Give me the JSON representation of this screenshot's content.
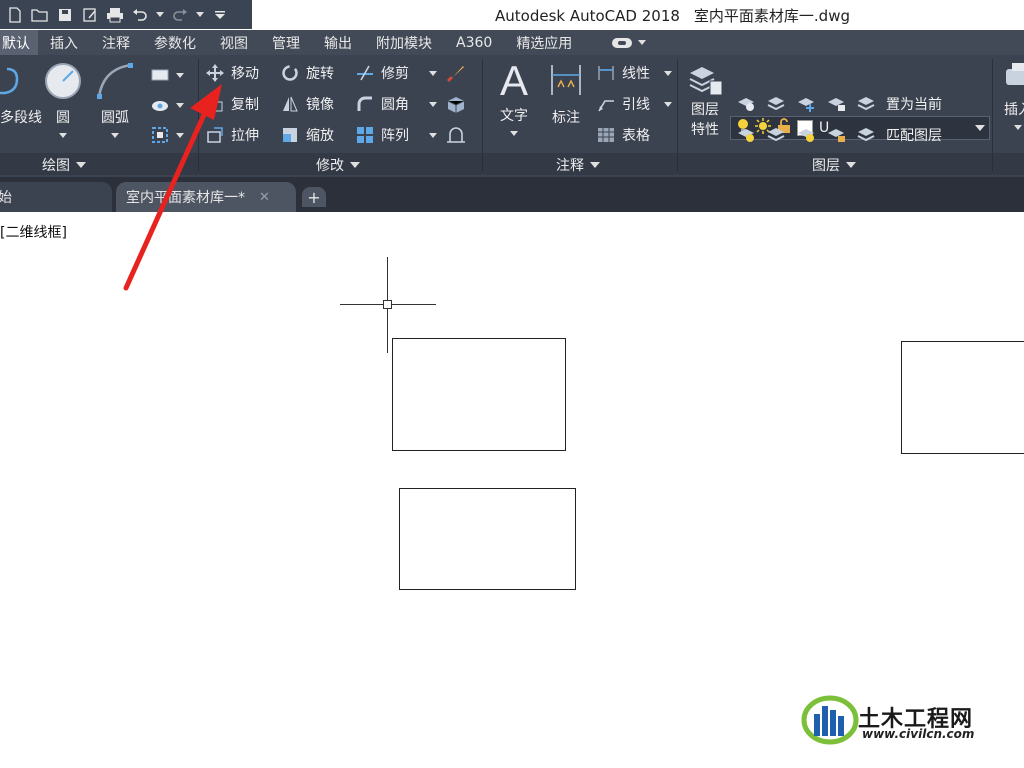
{
  "app": {
    "title": "Autodesk AutoCAD 2018",
    "filename": "室内平面素材库一.dwg"
  },
  "quick_access": [
    "new-icon",
    "open-icon",
    "save-icon",
    "saveas-icon",
    "print-icon",
    "undo-icon",
    "redo-icon",
    "customize-icon"
  ],
  "ribbon_tabs": [
    {
      "label": "默认",
      "active": true
    },
    {
      "label": "插入"
    },
    {
      "label": "注释"
    },
    {
      "label": "参数化"
    },
    {
      "label": "视图"
    },
    {
      "label": "管理"
    },
    {
      "label": "输出"
    },
    {
      "label": "附加模块"
    },
    {
      "label": "A360"
    },
    {
      "label": "精选应用"
    }
  ],
  "panels": {
    "draw": {
      "title": "绘图",
      "polyline": "多段线",
      "circle": "圆",
      "arc": "圆弧"
    },
    "modify": {
      "title": "修改",
      "move": "移动",
      "rotate": "旋转",
      "trim": "修剪",
      "copy": "复制",
      "mirror": "镜像",
      "fillet": "圆角",
      "stretch": "拉伸",
      "scale": "缩放",
      "array": "阵列"
    },
    "annotation": {
      "title": "注释",
      "text": "文字",
      "dimension": "标注",
      "linear": "线性",
      "leader": "引线",
      "table": "表格"
    },
    "layers": {
      "title": "图层",
      "properties_line1": "图层",
      "properties_line2": "特性",
      "current_layer": "U",
      "set_current": "置为当前",
      "match_layer": "匹配图层"
    },
    "insert": {
      "label": "插入"
    }
  },
  "doc_tabs": {
    "start_tab_partial": "始",
    "active_tab": "室内平面素材库一*"
  },
  "viewport": {
    "label": "[二维线框]"
  },
  "watermark": {
    "name": "土木工程网",
    "url": "www.civilcn.com"
  },
  "colors": {
    "ribbon_bg": "#3b4250",
    "tab_bg": "#424a57",
    "accent_arrow": "#e8231f"
  }
}
